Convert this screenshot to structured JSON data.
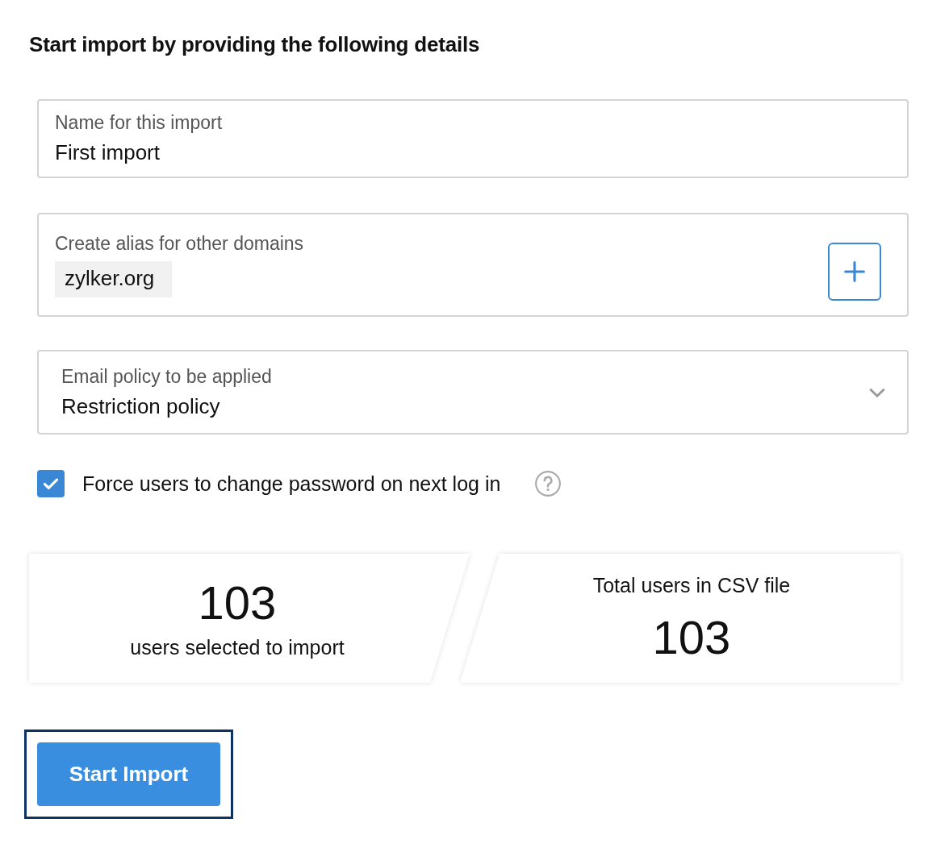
{
  "heading": "Start import by providing the following details",
  "fields": [
    {
      "kind": "text",
      "label": "Name for this import",
      "value": "First import"
    },
    {
      "kind": "tags",
      "label": "Create alias for other domains",
      "tags": [
        "zylker.org"
      ]
    },
    {
      "kind": "select",
      "label": "Email policy to be applied",
      "value": "Restriction policy"
    }
  ],
  "checkbox": {
    "label": "Force users to change password on next log in",
    "checked": true
  },
  "stats": [
    {
      "kind": "value-first",
      "value": "103",
      "caption": "users selected to import"
    },
    {
      "kind": "caption-first",
      "caption": "Total users in CSV file",
      "value": "103"
    }
  ],
  "button": {
    "label": "Start Import",
    "focused": true
  }
}
